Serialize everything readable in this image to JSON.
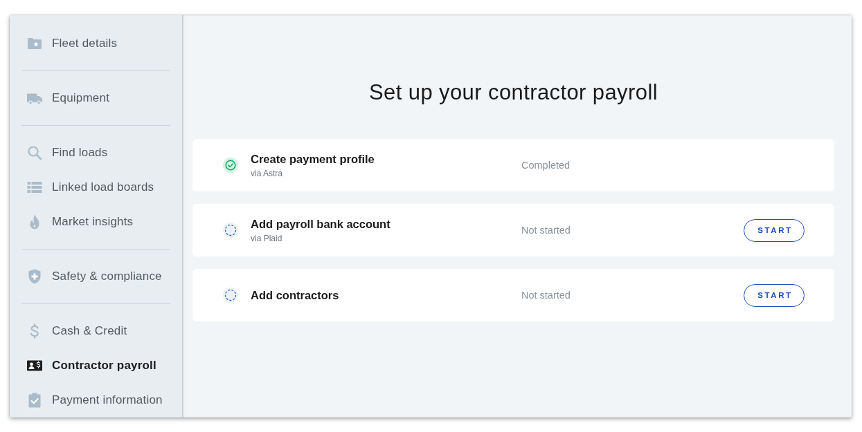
{
  "sidebar": {
    "groups": [
      {
        "items": [
          {
            "label": "Fleet details",
            "selected": false
          }
        ]
      },
      {
        "items": [
          {
            "label": "Equipment",
            "selected": false
          }
        ]
      },
      {
        "items": [
          {
            "label": "Find loads",
            "selected": false
          },
          {
            "label": "Linked load boards",
            "selected": false
          },
          {
            "label": "Market insights",
            "selected": false
          }
        ]
      },
      {
        "items": [
          {
            "label": "Safety & compliance",
            "selected": false
          }
        ]
      },
      {
        "items": [
          {
            "label": "Cash & Credit",
            "selected": false
          },
          {
            "label": "Contractor payroll",
            "selected": true
          },
          {
            "label": "Payment information",
            "selected": false
          }
        ]
      }
    ]
  },
  "main": {
    "title": "Set up your contractor payroll",
    "steps": [
      {
        "title": "Create payment profile",
        "subtitle": "via Astra",
        "status": "Completed",
        "completed": true
      },
      {
        "title": "Add payroll bank account",
        "subtitle": "via Plaid",
        "status": "Not started",
        "completed": false,
        "button": "START"
      },
      {
        "title": "Add contractors",
        "status": "Not started",
        "completed": false,
        "button": "START"
      }
    ]
  }
}
